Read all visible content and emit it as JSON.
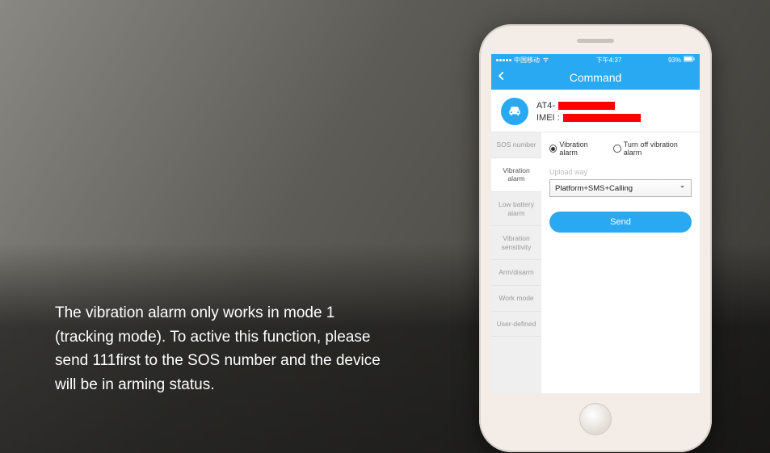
{
  "caption": "The vibration alarm only works in mode 1 (tracking mode). To active this function, please send 111first to the SOS number and the device will be in arming status.",
  "statusbar": {
    "carrier": "中国移动",
    "time": "下午4:37",
    "battery": "93%"
  },
  "titlebar": {
    "title": "Command"
  },
  "device": {
    "name_prefix": "AT4-",
    "imei_label": "IMEI :"
  },
  "sidebar": {
    "items": [
      {
        "label": "SOS number"
      },
      {
        "label": "Vibration alarm"
      },
      {
        "label": "Low battery alarm"
      },
      {
        "label": "Vibration sensitivity"
      },
      {
        "label": "Arm/disarm"
      },
      {
        "label": "Work mode"
      },
      {
        "label": "User-defined"
      }
    ],
    "active_index": 1
  },
  "panel": {
    "radio_options": [
      "Vibration alarm",
      "Turn off vibration alarm"
    ],
    "radio_selected": 0,
    "upload_label": "Upload way",
    "upload_value": "Platform+SMS+Calling",
    "send_label": "Send"
  }
}
